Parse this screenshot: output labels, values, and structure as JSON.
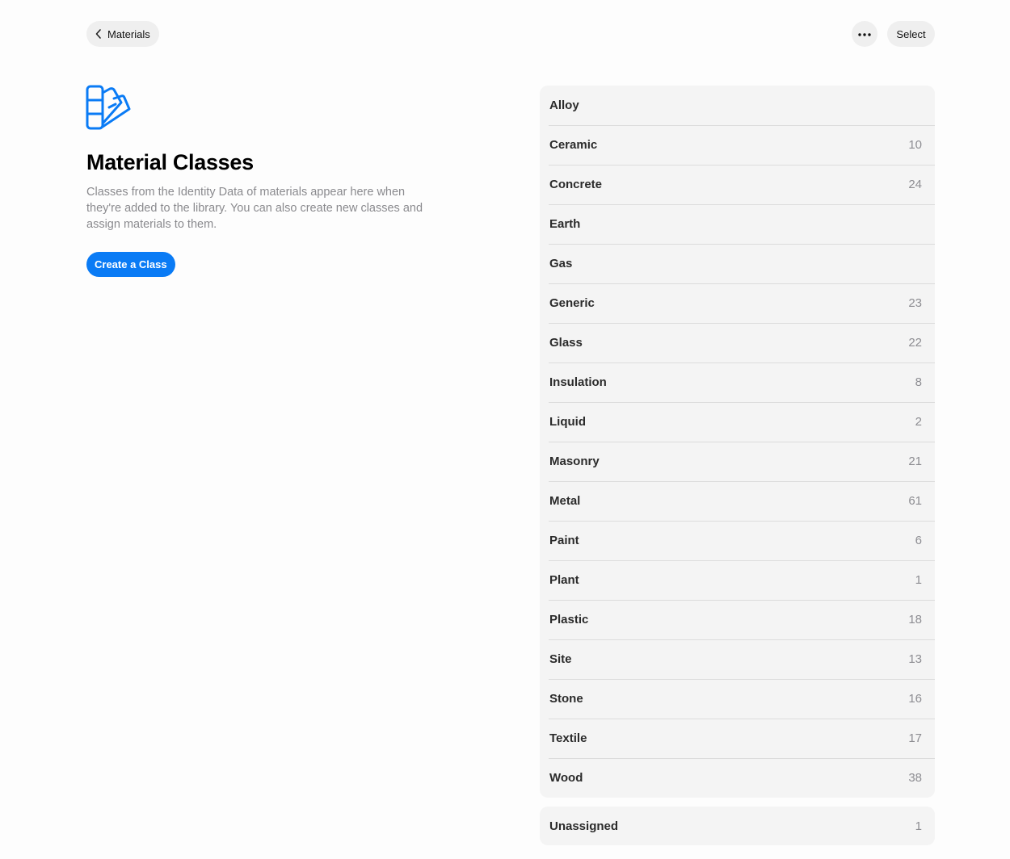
{
  "topbar": {
    "back_label": "Materials",
    "back_icon": "chevron-left-icon",
    "more_icon": "ellipsis-icon",
    "select_label": "Select"
  },
  "header": {
    "icon": "material-swatch-icon",
    "title": "Material Classes",
    "description": "Classes from the Identity Data of materials appear here when they're added to the library. You can also create new classes and assign materials to them.",
    "create_button_label": "Create a Class"
  },
  "colors": {
    "accent": "#0a7bf5",
    "list_background": "#f4f4f4"
  },
  "classes": [
    {
      "name": "Alloy",
      "count": ""
    },
    {
      "name": "Ceramic",
      "count": "10"
    },
    {
      "name": "Concrete",
      "count": "24"
    },
    {
      "name": "Earth",
      "count": ""
    },
    {
      "name": "Gas",
      "count": ""
    },
    {
      "name": "Generic",
      "count": "23"
    },
    {
      "name": "Glass",
      "count": "22"
    },
    {
      "name": "Insulation",
      "count": "8"
    },
    {
      "name": "Liquid",
      "count": "2"
    },
    {
      "name": "Masonry",
      "count": "21"
    },
    {
      "name": "Metal",
      "count": "61"
    },
    {
      "name": "Paint",
      "count": "6"
    },
    {
      "name": "Plant",
      "count": "1"
    },
    {
      "name": "Plastic",
      "count": "18"
    },
    {
      "name": "Site",
      "count": "13"
    },
    {
      "name": "Stone",
      "count": "16"
    },
    {
      "name": "Textile",
      "count": "17"
    },
    {
      "name": "Wood",
      "count": "38"
    }
  ],
  "unassigned": {
    "name": "Unassigned",
    "count": "1"
  }
}
